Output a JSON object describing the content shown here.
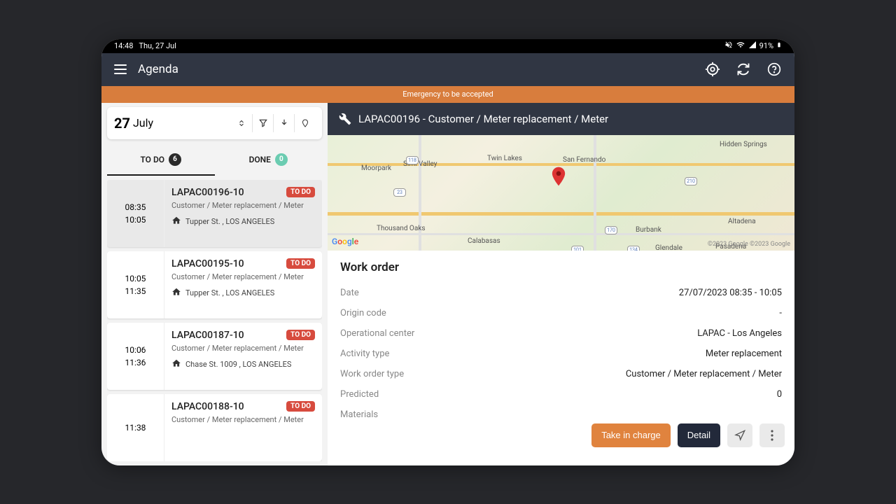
{
  "status_bar": {
    "time": "14:48",
    "date": "Thu, 27 Jul",
    "battery": "91%"
  },
  "header": {
    "title": "Agenda"
  },
  "emergency": "Emergency to be accepted",
  "date_selector": {
    "day": "27",
    "month": "July"
  },
  "tabs": {
    "todo_label": "TO DO",
    "todo_count": "6",
    "done_label": "DONE",
    "done_count": "0"
  },
  "work_orders": [
    {
      "start": "08:35",
      "end": "10:05",
      "id": "LAPAC00196-10",
      "status": "TO DO",
      "desc": "Customer / Meter replacement / Meter",
      "addr": "Tupper St. , LOS ANGELES",
      "selected": true
    },
    {
      "start": "10:05",
      "end": "11:35",
      "id": "LAPAC00195-10",
      "status": "TO DO",
      "desc": "Customer / Meter replacement / Meter",
      "addr": "Tupper St. , LOS ANGELES",
      "selected": false
    },
    {
      "start": "10:06",
      "end": "11:36",
      "id": "LAPAC00187-10",
      "status": "TO DO",
      "desc": "Customer / Meter replacement / Meter",
      "addr": "Chase St. 1009 , LOS ANGELES",
      "selected": false
    },
    {
      "start": "11:38",
      "end": "",
      "id": "LAPAC00188-10",
      "status": "TO DO",
      "desc": "Customer / Meter replacement / Meter",
      "addr": "",
      "selected": false
    }
  ],
  "detail": {
    "header": "LAPAC00196 - Customer / Meter replacement / Meter",
    "section_title": "Work order",
    "fields": [
      {
        "label": "Date",
        "value": "27/07/2023 08:35 - 10:05"
      },
      {
        "label": "Origin code",
        "value": "-"
      },
      {
        "label": "Operational center",
        "value": "LAPAC - Los Angeles"
      },
      {
        "label": "Activity type",
        "value": "Meter replacement"
      },
      {
        "label": "Work order type",
        "value": "Customer / Meter replacement / Meter"
      },
      {
        "label": "Predicted",
        "value": "0"
      },
      {
        "label": "Materials",
        "value": ""
      }
    ],
    "actions": {
      "take_in_charge": "Take in charge",
      "detail": "Detail"
    }
  },
  "map": {
    "labels": {
      "moorpark": "Moorpark",
      "simi_valley": "Simi Valley",
      "twin_lakes": "Twin Lakes",
      "san_fernando": "San Fernando",
      "thousand_oaks": "Thousand Oaks",
      "calabasas": "Calabasas",
      "burbank": "Burbank",
      "glendale": "Glendale",
      "altadena": "Altadena",
      "pasadena": "Pasadena",
      "hidden_springs": "Hidden Springs"
    },
    "credit": "©2023 Google ©2023 Google"
  }
}
